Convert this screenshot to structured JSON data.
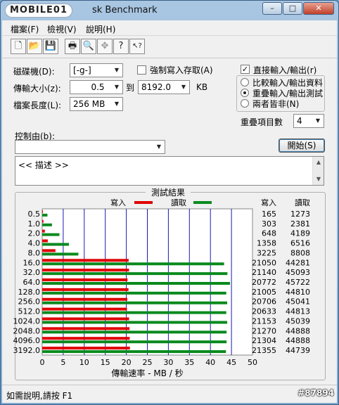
{
  "window": {
    "logo": "MOBILE01",
    "title": "sk Benchmark",
    "min_glyph": "–",
    "max_glyph": "□",
    "close_glyph": "✕"
  },
  "menu": [
    "檔案(F)",
    "檢視(V)",
    "說明(H)"
  ],
  "toolbar_icons": [
    "new-file-icon",
    "open-folder-icon",
    "save-icon",
    "print-icon",
    "print-preview-icon",
    "move-icon",
    "help-icon",
    "context-help-icon"
  ],
  "toolbar_glyphs": [
    "🗋",
    "📂",
    "💾",
    "🖶",
    "🔍",
    "✥",
    "?",
    "↖?"
  ],
  "form": {
    "drive_label": "磁碟機(D):",
    "drive_value": "[-g-]",
    "transfer_label": "傳輸大小(z):",
    "transfer_from": "0.5",
    "to_label": "到",
    "transfer_to": "8192.0",
    "kb_label": "KB",
    "length_label": "檔案長度(L):",
    "length_value": "256 MB",
    "force_write_label": "強制寫入存取(A)",
    "force_write_checked": false,
    "direct_io_label": "直接輸入/輸出(r)",
    "direct_io_checked": true,
    "radio_compare": "比較輸入/輸出資料",
    "radio_overlap": "重疊輸入/輸出測試",
    "radio_neither": "兩者皆非(N)",
    "queue_label": "重疊項目數",
    "queue_value": "4",
    "control_label": "控制由(b):",
    "control_value": "",
    "start_button": "開始(S)",
    "desc_text": "<<    描述    >>"
  },
  "results_title": "測試結果",
  "legend_write": "寫入",
  "legend_read": "讀取",
  "col_write": "寫入",
  "col_read": "讀取",
  "chart_data": {
    "type": "bar",
    "orientation": "horizontal",
    "title": "測試結果",
    "xlabel": "傳輸速率 - MB / 秒",
    "xlim": [
      0,
      50
    ],
    "xticks": [
      0,
      5,
      10,
      15,
      20,
      25,
      30,
      35,
      40,
      45,
      50
    ],
    "categories": [
      "0.5",
      "1.0",
      "2.0",
      "4.0",
      "8.0",
      "16.0",
      "32.0",
      "64.0",
      "128.0",
      "256.0",
      "512.0",
      "1024.0",
      "2048.0",
      "4096.0",
      "3192.0"
    ],
    "series": [
      {
        "name": "寫入",
        "color": "#e00000",
        "values": [
          165,
          303,
          648,
          1358,
          3225,
          21050,
          21140,
          20772,
          21005,
          20706,
          20633,
          21153,
          21270,
          21304,
          21355
        ]
      },
      {
        "name": "讀取",
        "color": "#0a8a1e",
        "values": [
          1273,
          2381,
          4189,
          6516,
          8808,
          44281,
          45093,
          45722,
          44810,
          45041,
          44813,
          45039,
          44888,
          44888,
          44739
        ]
      }
    ],
    "value_unit": "KB/s"
  },
  "status": {
    "help_text": "如需說明,請按 F1",
    "watermark": "#87894"
  }
}
